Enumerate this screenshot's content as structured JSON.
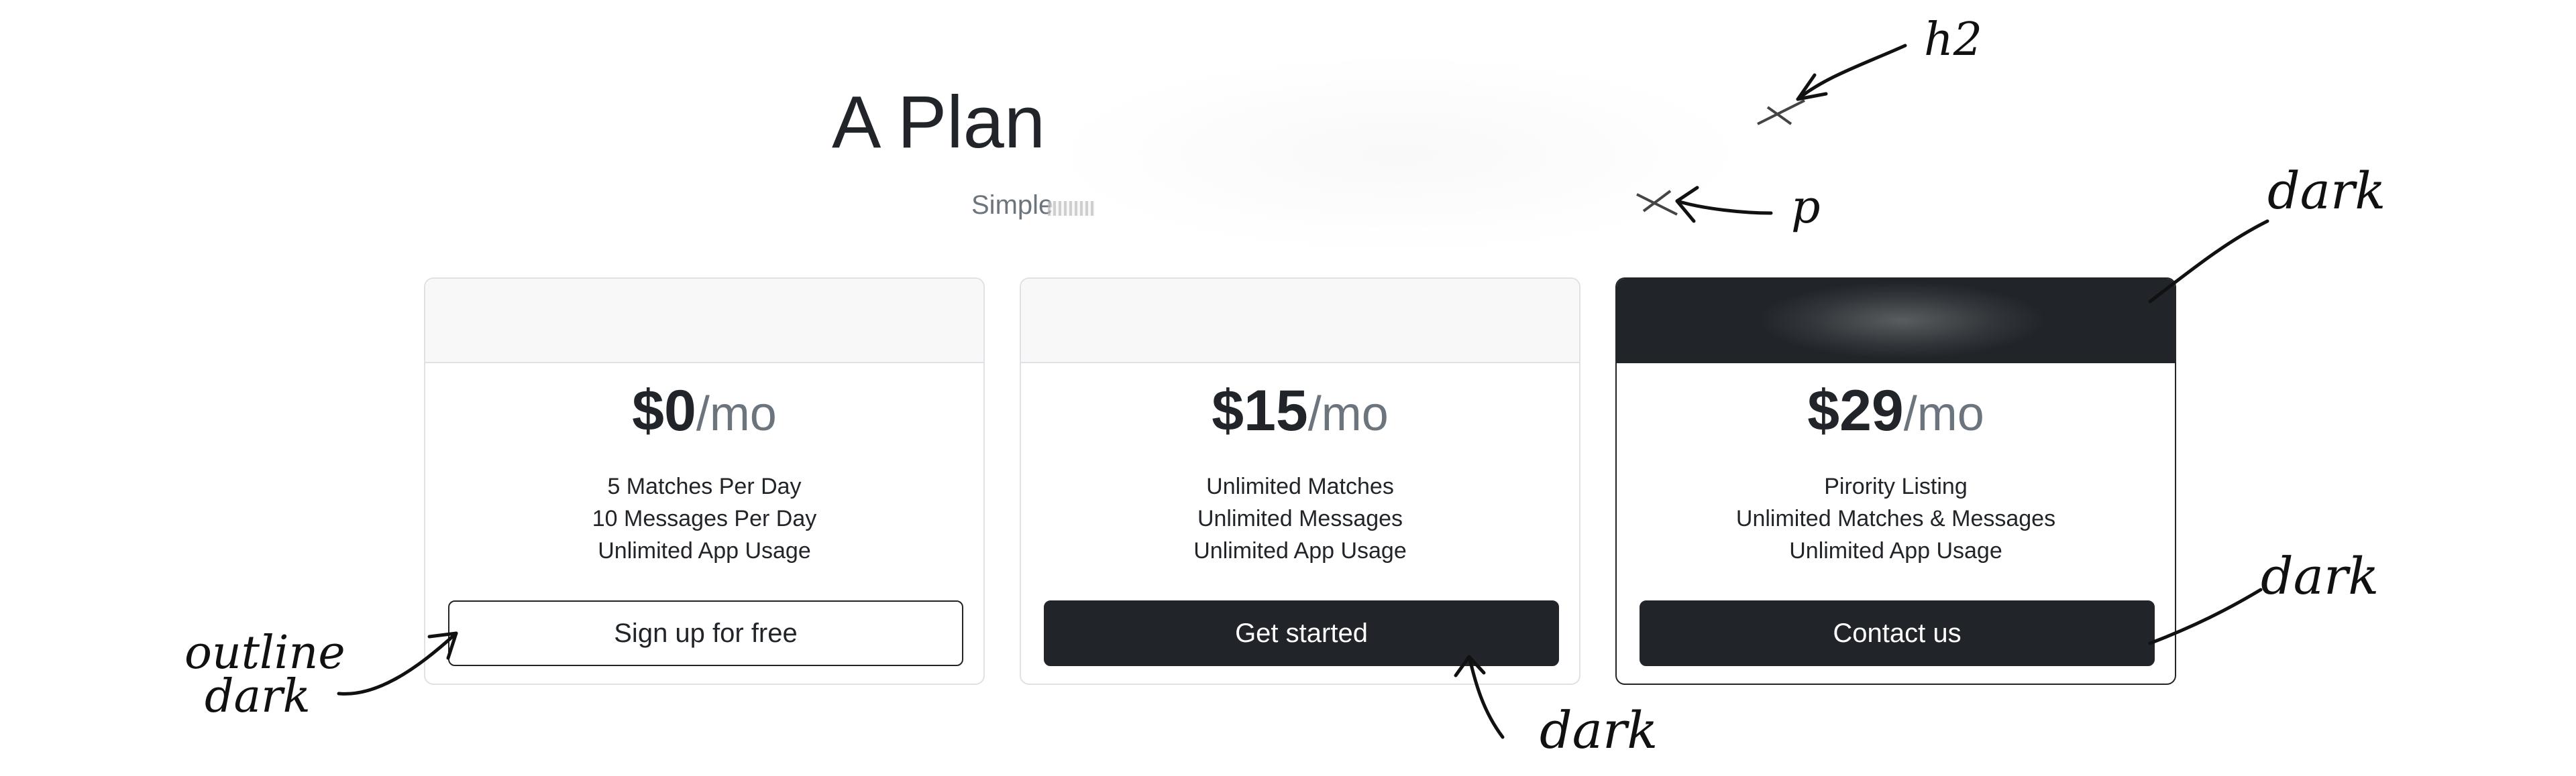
{
  "header": {
    "title": "A Plan",
    "subtitle": "Simple"
  },
  "plans": [
    {
      "price": "$0",
      "period": "/mo",
      "features": [
        "5 Matches Per Day",
        "10 Messages Per Day",
        "Unlimited App Usage"
      ],
      "button_label": "Sign up for free"
    },
    {
      "price": "$15",
      "period": "/mo",
      "features": [
        "Unlimited Matches",
        "Unlimited Messages",
        "Unlimited App Usage"
      ],
      "button_label": "Get started"
    },
    {
      "price": "$29",
      "period": "/mo",
      "features": [
        "Pirority Listing",
        "Unlimited Matches & Messages",
        "Unlimited App Usage"
      ],
      "button_label": "Contact us"
    }
  ],
  "annotations": {
    "h2": "h2",
    "p": "p",
    "dark_header": "dark",
    "dark_contact": "dark",
    "dark_started": "dark",
    "outline_1": "outline",
    "outline_2": "dark"
  },
  "colors": {
    "dark": "#212529",
    "muted": "#6c757d",
    "border": "#dee2e6",
    "header_bg": "#f8f8f8"
  }
}
